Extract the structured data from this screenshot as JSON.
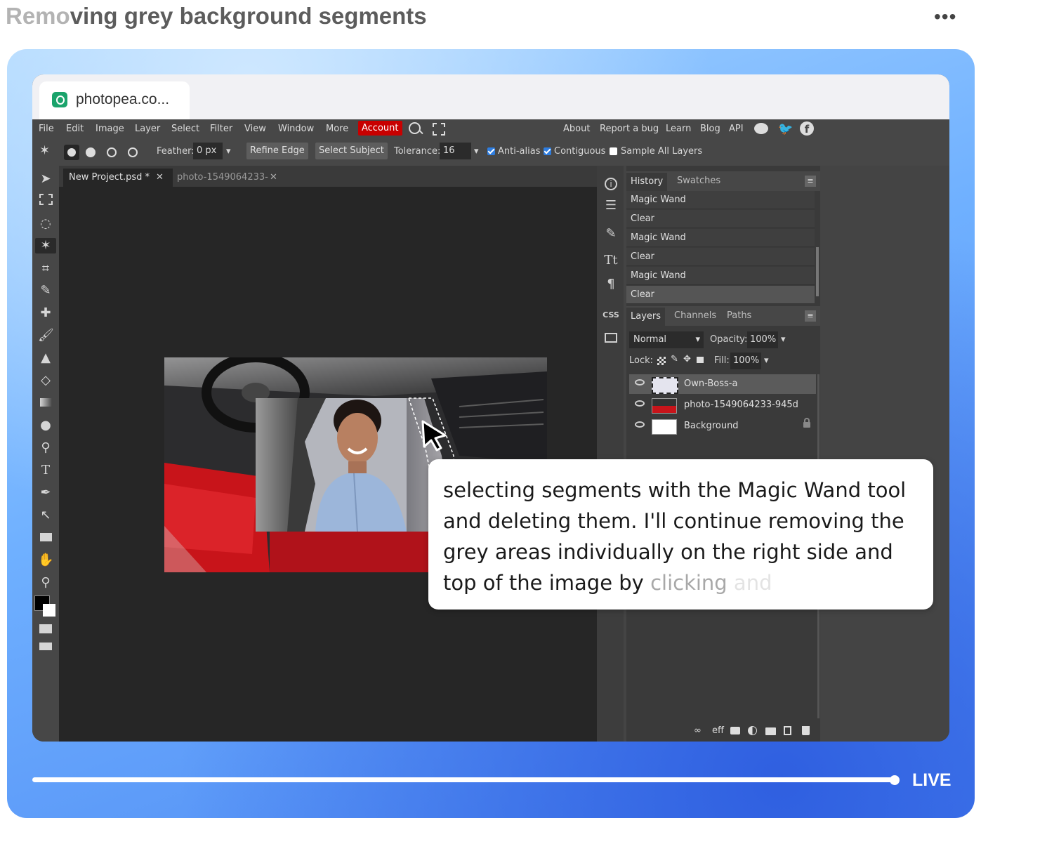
{
  "header": {
    "title_faded": "Remo",
    "title_rest": "ving grey background segments",
    "more_label": "•••"
  },
  "browser_tab": {
    "url": "photopea.co..."
  },
  "menu": {
    "items": [
      "File",
      "Edit",
      "Image",
      "Layer",
      "Select",
      "Filter",
      "View",
      "Window",
      "More"
    ],
    "account": "Account",
    "right_items": [
      "About",
      "Report a bug",
      "Learn",
      "Blog",
      "API"
    ]
  },
  "options": {
    "feather_label": "Feather:",
    "feather_value": "0 px",
    "refine_edge": "Refine Edge",
    "select_subject": "Select Subject",
    "tolerance_label": "Tolerance:",
    "tolerance_value": "16",
    "anti_alias": "Anti-alias",
    "contiguous": "Contiguous",
    "sample_all_layers": "Sample All Layers"
  },
  "doc_tabs": [
    {
      "label": "New Project.psd *",
      "active": true
    },
    {
      "label": "photo-1549064233-",
      "active": false
    }
  ],
  "history_panel": {
    "tabs": [
      "History",
      "Swatches"
    ],
    "items": [
      "Magic Wand",
      "Clear",
      "Magic Wand",
      "Clear",
      "Magic Wand",
      "Clear"
    ]
  },
  "layers_panel": {
    "tabs": [
      "Layers",
      "Channels",
      "Paths"
    ],
    "blend_mode": "Normal",
    "opacity_label": "Opacity:",
    "opacity_value": "100%",
    "lock_label": "Lock:",
    "fill_label": "Fill:",
    "fill_value": "100%",
    "layers": [
      {
        "name": "Own-Boss-a",
        "selected": true
      },
      {
        "name": "photo-1549064233-945d",
        "selected": false
      },
      {
        "name": "Background",
        "selected": false,
        "locked": true
      }
    ],
    "footer_icons": [
      "link-icon",
      "effects-icon",
      "mask-icon",
      "adjustment-icon",
      "folder-icon",
      "new-layer-icon",
      "trash-icon"
    ],
    "effects_label": "eff"
  },
  "caption": {
    "text_main": "selecting segments with the Magic Wand tool and deleting them. I'll continue removing the grey areas individually on the right side and top of the image by ",
    "text_fade1": "clicking",
    "text_fade2": " and"
  },
  "player": {
    "live_label": "LIVE",
    "progress": 1.0
  },
  "colors": {
    "accent_red": "#c80000",
    "frame_blue": "#6fb0ff",
    "checkbox_blue": "#2e7de0"
  }
}
